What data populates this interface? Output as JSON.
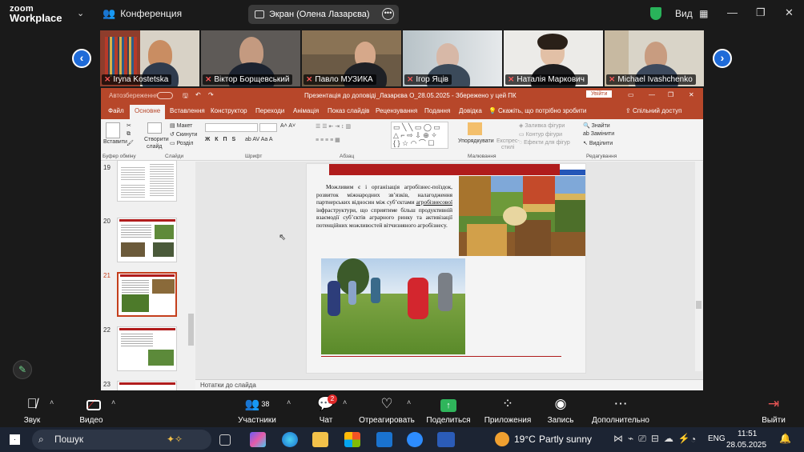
{
  "zoom": {
    "logo_line1": "zoom",
    "logo_line2": "Workplace",
    "meeting_label": "Конференция",
    "screen_share_label": "Экран (Олена Лазарєва)",
    "view_label": "Вид",
    "participants": [
      {
        "name": "Iryna Kostetska"
      },
      {
        "name": "Віктор Борщевський"
      },
      {
        "name": "Павло МУЗИКА"
      },
      {
        "name": "Ігор Яців"
      },
      {
        "name": "Наталія Маркович"
      },
      {
        "name": "Michael Ivashchenko"
      }
    ],
    "toolbar": {
      "audio": "Звук",
      "video": "Видео",
      "participants": "Участники",
      "participants_count": "38",
      "chat": "Чат",
      "chat_badge": "2",
      "react": "Отреагировать",
      "share": "Поделиться",
      "apps": "Приложения",
      "record": "Запись",
      "more": "Дополнительно",
      "leave": "Выйти"
    }
  },
  "powerpoint": {
    "autosave": "Автозбереження",
    "title": "Презентація до доповіді_Лазарєва О_28.05.2025 - Збережено у цей ПК",
    "signin": "Увійти",
    "tabs": [
      "Файл",
      "Основне",
      "Вставлення",
      "Конструктор",
      "Переходи",
      "Анімація",
      "Показ слайдів",
      "Рецензування",
      "Подання",
      "Довідка"
    ],
    "tell_me": "Скажіть, що потрібно зробити",
    "share": "Спільний доступ",
    "ribbon": {
      "paste": "Вставити",
      "clipboard": "Буфер обміну",
      "new_slide_1": "Створити",
      "new_slide_2": "слайд",
      "layout": "Макет",
      "reset": "Скинути",
      "sections": "Розділ",
      "slides_group": "Слайди",
      "font_group": "Шрифт",
      "paragraph_group": "Абзац",
      "arrange": "Упорядкувати",
      "quick_styles_1": "Експрес-",
      "quick_styles_2": "стилі",
      "fill": "Заливка фігури",
      "outline": "Контур фігури",
      "effects": "Ефекти для фігур",
      "drawing_group": "Малювання",
      "find": "Знайти",
      "replace": "Замінити",
      "select": "Виділити",
      "editing_group": "Редагування"
    },
    "thumbnails": [
      {
        "num": "19"
      },
      {
        "num": "20"
      },
      {
        "num": "21",
        "selected": true
      },
      {
        "num": "22"
      },
      {
        "num": "23"
      }
    ],
    "slide_text_before": "Можливим є і організація агробізнес-поїздок, розвиток міжнародних зв’язків, налагодження партнерських відносин між суб’єктами ",
    "slide_text_link": "агробізнесової",
    "slide_text_after": " інфраструктури, що сприятиме більш продуктивній взаємодії суб’єктів аграрного ринку та активізації потенційних можливостей вітчизняного агробізнесу.",
    "notes": "Нотатки до слайда"
  },
  "taskbar": {
    "search": "Пошук",
    "weather_temp": "19°C",
    "weather_text": "Partly sunny",
    "lang": "ENG",
    "time": "11:51",
    "date": "28.05.2025"
  }
}
